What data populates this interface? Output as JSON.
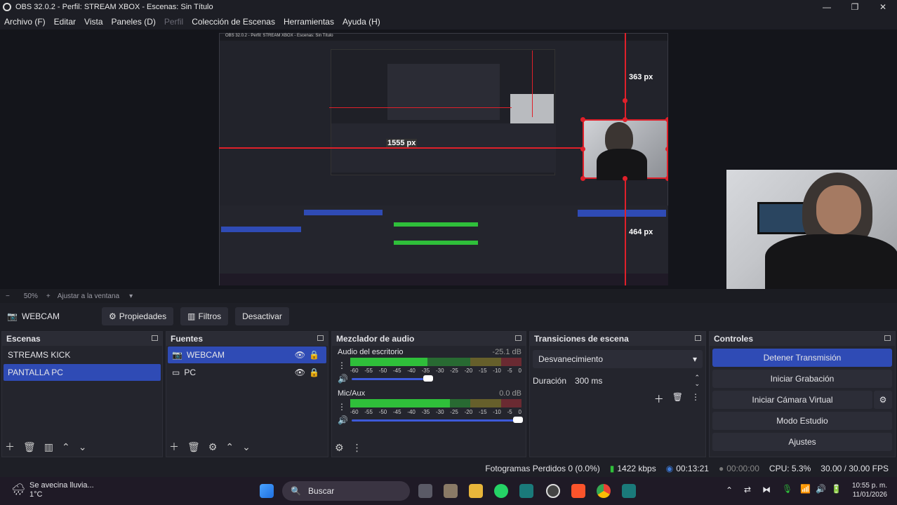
{
  "window": {
    "title": "OBS 32.0.2 - Perfil: STREAM XBOX - Escenas: Sin Título",
    "minimize": "—",
    "maximize": "❐",
    "close": "✕"
  },
  "menu": [
    "Archivo (F)",
    "Editar",
    "Vista",
    "Paneles (D)",
    "Perfil",
    "Colección de Escenas",
    "Herramientas",
    "Ayuda (H)"
  ],
  "menu_disabled": "Perfil",
  "preview": {
    "labels": [
      "363 px",
      "1555 px",
      "464 px"
    ],
    "nested_title": "OBS 32.0.2 - Perfil: STREAM XBOX - Escenas: Sin Título"
  },
  "zoom": {
    "minus": "−",
    "level": "50%",
    "plus": "+",
    "fit": "Ajustar a la ventana"
  },
  "source_toolbar": {
    "source_name": "WEBCAM",
    "properties": "Propiedades",
    "filters": "Filtros",
    "deactivate": "Desactivar"
  },
  "scenes": {
    "title": "Escenas",
    "items": [
      "STREAMS KICK",
      "PANTALLA PC"
    ],
    "selected": "PANTALLA PC"
  },
  "sources": {
    "title": "Fuentes",
    "items": [
      "WEBCAM",
      "PC"
    ],
    "selected": "WEBCAM"
  },
  "mixer": {
    "title": "Mezclador de audio",
    "channels": [
      {
        "name": "Audio del escritorio",
        "db": "-25.1 dB",
        "level": 0.45,
        "volume": 0.42
      },
      {
        "name": "Mic/Aux",
        "db": "0.0 dB",
        "level": 0.58,
        "volume": 0.97
      }
    ],
    "ticks": [
      "-60",
      "-55",
      "-50",
      "-45",
      "-40",
      "-35",
      "-30",
      "-25",
      "-20",
      "-15",
      "-10",
      "-5",
      "0"
    ]
  },
  "transitions": {
    "title": "Transiciones de escena",
    "selected": "Desvanecimiento",
    "duration_label": "Duración",
    "duration_value": "300 ms"
  },
  "controls": {
    "title": "Controles",
    "stop_stream": "Detener Transmisión",
    "start_rec": "Iniciar Grabación",
    "virtual_cam": "Iniciar Cámara Virtual",
    "studio": "Modo Estudio",
    "settings": "Ajustes"
  },
  "status": {
    "dropped": "Fotogramas Perdidos 0 (0.0%)",
    "bitrate": "1422 kbps",
    "stream_time": "00:13:21",
    "rec_time": "00:00:00",
    "cpu": "CPU: 5.3%",
    "fps": "30.00 / 30.00 FPS"
  },
  "taskbar": {
    "weather_line1": "Se avecina lluvia...",
    "weather_line2": "1°C",
    "search": "Buscar",
    "time": "10:55 p. m.",
    "date": "11/01/2026"
  },
  "colors": {
    "accent": "#2f4bb5",
    "meter_green": "#2fbf3a",
    "meter_yellow": "#b9a62a",
    "meter_red": "#c0303a",
    "guide_red": "#e0202a"
  }
}
